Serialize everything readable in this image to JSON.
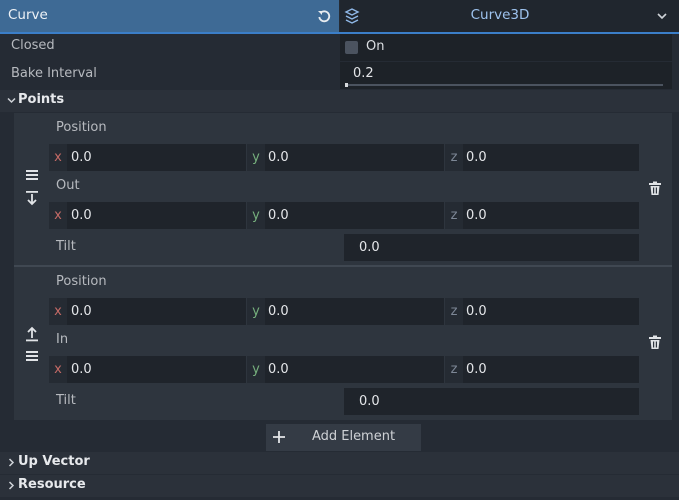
{
  "header": {
    "property": "Curve",
    "resource_type": "Curve3D"
  },
  "closed": {
    "label": "Closed",
    "toggle_label": "On",
    "checked": false
  },
  "bake_interval": {
    "label": "Bake Interval",
    "value": "0.2"
  },
  "points": {
    "label": "Points",
    "elements": [
      {
        "position_label": "Position",
        "position": {
          "x": "0.0",
          "y": "0.0",
          "z": "0.0"
        },
        "handle_label": "Out",
        "handle": {
          "x": "0.0",
          "y": "0.0",
          "z": "0.0"
        },
        "tilt_label": "Tilt",
        "tilt": "0.0"
      },
      {
        "position_label": "Position",
        "position": {
          "x": "0.0",
          "y": "0.0",
          "z": "0.0"
        },
        "handle_label": "In",
        "handle": {
          "x": "0.0",
          "y": "0.0",
          "z": "0.0"
        },
        "tilt_label": "Tilt",
        "tilt": "0.0"
      }
    ],
    "add_element_label": "Add Element"
  },
  "axes": {
    "x": "x",
    "y": "y",
    "z": "z"
  },
  "sections": {
    "up_vector": "Up Vector",
    "resource": "Resource"
  },
  "icons": {
    "revert": "revert-icon",
    "resource": "curve3d-resource-icon",
    "dropdown": "chevron-down-icon",
    "drag": "drag-handle-icon",
    "move_down": "move-down-icon",
    "move_up": "move-up-icon",
    "delete": "trash-icon",
    "add": "plus-icon"
  },
  "colors": {
    "accent": "#3e6a95",
    "accent_line": "#3b7ec8",
    "resource_text": "#9ec3ef",
    "axis_x": "#c46a66",
    "axis_y": "#76b07d"
  }
}
